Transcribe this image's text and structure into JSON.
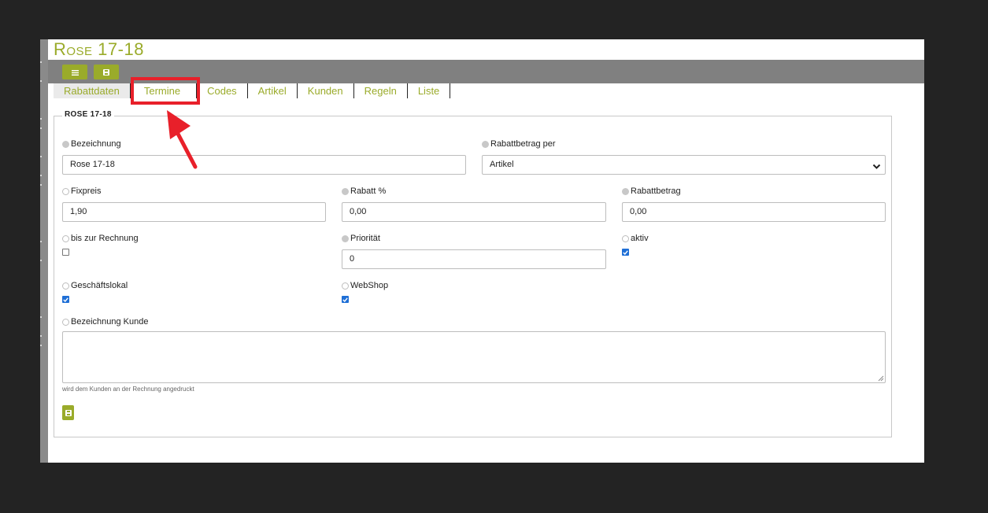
{
  "title": "Rose 17-18",
  "toolbar": {
    "menu_icon": "list-icon",
    "save_icon": "save-icon"
  },
  "tabs": [
    {
      "label": "Rabattdaten"
    },
    {
      "label": "Termine"
    },
    {
      "label": "Codes"
    },
    {
      "label": "Artikel"
    },
    {
      "label": "Kunden"
    },
    {
      "label": "Regeln"
    },
    {
      "label": "Liste"
    }
  ],
  "form": {
    "legend": "ROSE 17-18",
    "bezeichnung": {
      "label": "Bezeichnung",
      "value": "Rose 17-18"
    },
    "rabattbetrag_per": {
      "label": "Rabattbetrag per",
      "value": "Artikel"
    },
    "fixpreis": {
      "label": "Fixpreis",
      "value": "1,90"
    },
    "rabatt_pct": {
      "label": "Rabatt %",
      "value": "0,00"
    },
    "rabattbetrag": {
      "label": "Rabattbetrag",
      "value": "0,00"
    },
    "bis_zur_rechnung": {
      "label": "bis zur Rechnung",
      "checked": false
    },
    "prioritaet": {
      "label": "Priorität",
      "value": "0"
    },
    "aktiv": {
      "label": "aktiv",
      "checked": true
    },
    "geschaeftslokal": {
      "label": "Geschäftslokal",
      "checked": true
    },
    "webshop": {
      "label": "WebShop",
      "checked": true
    },
    "bezeichnung_kunde": {
      "label": "Bezeichnung Kunde",
      "value": "",
      "hint": "wird dem Kunden an der Rechnung angedruckt"
    }
  },
  "colors": {
    "accent": "#9aab2a",
    "highlight": "#e8202a",
    "checkbox": "#1f6fd6"
  }
}
